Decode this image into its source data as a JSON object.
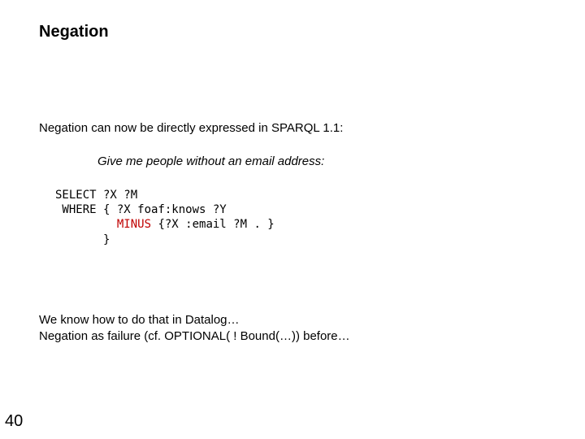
{
  "title": "Negation",
  "intro": "Negation can now be directly expressed in SPARQL 1.1:",
  "subtitle": "Give me people without an email address:",
  "code": {
    "l1a": "SELECT ?X ?M",
    "l2a": " WHERE { ?X foaf:knows ?Y",
    "l3pad": "         ",
    "l3kw": "MINUS",
    "l3b": " {?X :email ?M . }",
    "l4": "       }"
  },
  "note1": "We know how to do that in Datalog…",
  "note2": "Negation as failure (cf. OPTIONAL( ! Bound(…)) before…",
  "page": "40"
}
